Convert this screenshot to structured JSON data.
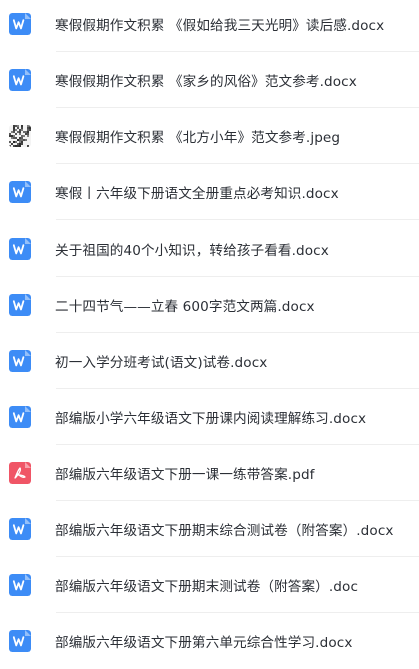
{
  "files": [
    {
      "name": "寒假假期作文积累 《假如给我三天光明》读后感.docx",
      "type": "word-doc-icon"
    },
    {
      "name": "寒假假期作文积累 《家乡的风俗》范文参考.docx",
      "type": "word-doc-icon"
    },
    {
      "name": "寒假假期作文积累 《北方小年》范文参考.jpeg",
      "type": "image-thumbnail-icon"
    },
    {
      "name": "寒假丨六年级下册语文全册重点必考知识.docx",
      "type": "word-doc-icon"
    },
    {
      "name": "关于祖国的40个小知识，转给孩子看看.docx",
      "type": "word-doc-icon"
    },
    {
      "name": "二十四节气——立春 600字范文两篇.docx",
      "type": "word-doc-icon"
    },
    {
      "name": "初一入学分班考试(语文)试卷.docx",
      "type": "word-doc-icon"
    },
    {
      "name": "部编版小学六年级语文下册课内阅读理解练习.docx",
      "type": "word-doc-icon"
    },
    {
      "name": "部编版六年级语文下册一课一练带答案.pdf",
      "type": "pdf-icon"
    },
    {
      "name": "部编版六年级语文下册期末综合测试卷（附答案）.docx",
      "type": "word-doc-icon"
    },
    {
      "name": "部编版六年级语文下册期末测试卷（附答案）.doc",
      "type": "word-doc-icon"
    },
    {
      "name": "部编版六年级语文下册第六单元综合性学习.docx",
      "type": "word-doc-icon"
    }
  ],
  "colors": {
    "word": "#3d8cf6",
    "pdf": "#f05566",
    "text": "#2b2f36",
    "divider": "#eeeeee"
  }
}
